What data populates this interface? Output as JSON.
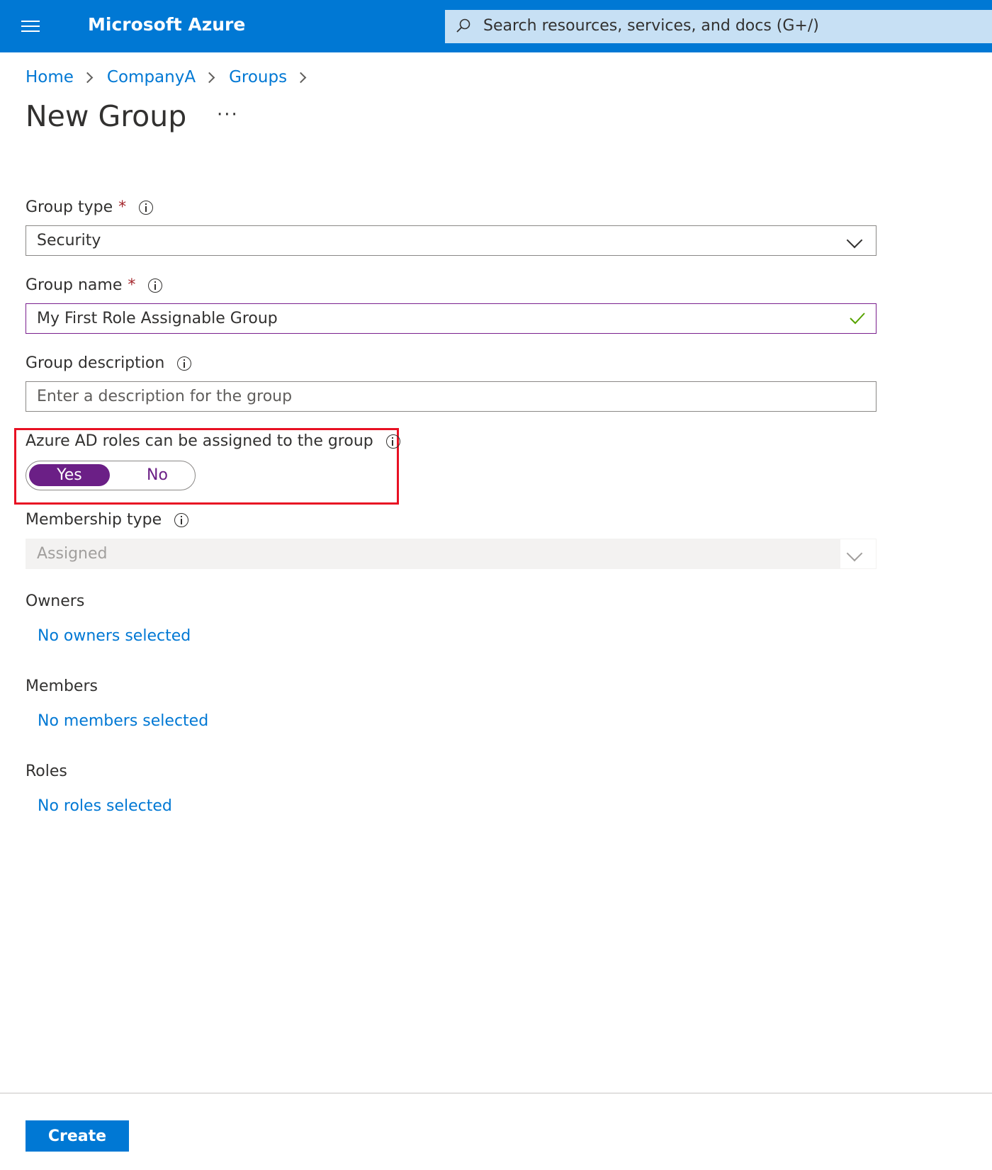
{
  "header": {
    "brand": "Microsoft Azure",
    "search_placeholder": "Search resources, services, and docs (G+/)"
  },
  "breadcrumb": [
    "Home",
    "CompanyA",
    "Groups"
  ],
  "page": {
    "title": "New Group",
    "more": "···"
  },
  "form": {
    "group_type": {
      "label": "Group type",
      "required": "*",
      "value": "Security"
    },
    "group_name": {
      "label": "Group name",
      "required": "*",
      "value": "My First Role Assignable Group"
    },
    "group_description": {
      "label": "Group description",
      "placeholder": "Enter a description for the group"
    },
    "azure_ad_roles": {
      "label": "Azure AD roles can be assigned to the group",
      "yes": "Yes",
      "no": "No",
      "selected": "Yes"
    },
    "membership_type": {
      "label": "Membership type",
      "value": "Assigned"
    },
    "owners": {
      "label": "Owners",
      "link": "No owners selected"
    },
    "members": {
      "label": "Members",
      "link": "No members selected"
    },
    "roles": {
      "label": "Roles",
      "link": "No roles selected"
    }
  },
  "footer": {
    "create": "Create"
  },
  "colors": {
    "brand_blue": "#0078d4",
    "toggle_purple": "#6b1f86",
    "highlight_red": "#e81123",
    "valid_green": "#57a300"
  }
}
